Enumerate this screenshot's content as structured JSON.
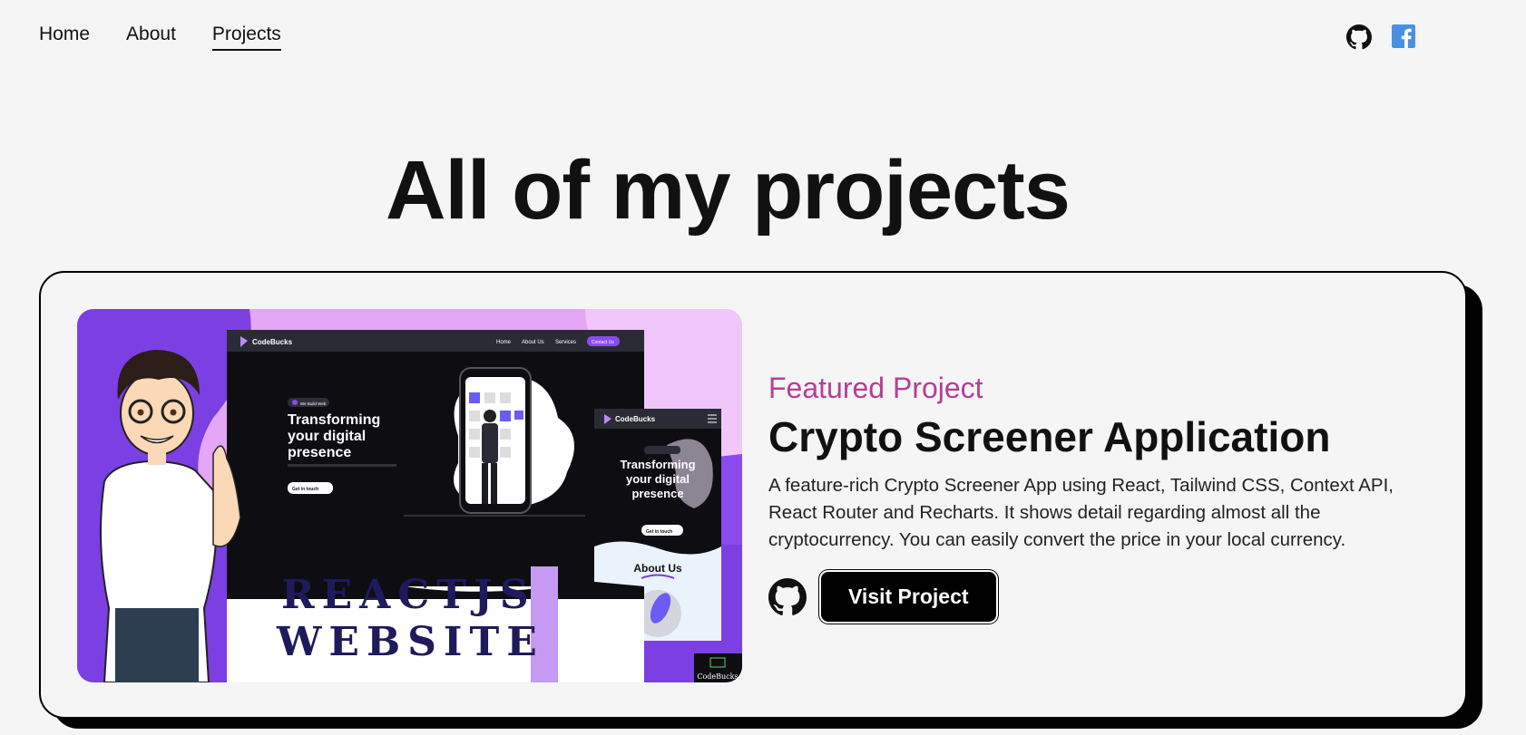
{
  "nav": {
    "items": [
      {
        "label": "Home"
      },
      {
        "label": "About"
      },
      {
        "label": "Projects",
        "active": true
      }
    ]
  },
  "socials": [
    "github-icon",
    "facebook-icon"
  ],
  "page": {
    "title": "All of my projects"
  },
  "project": {
    "tag": "Featured Project",
    "title": "Crypto Screener Application",
    "description": "A feature-rich Crypto Screener App using React, Tailwind CSS, Context API, React Router and Recharts. It shows detail regarding almost all the cryptocurrency. You can easily convert the price in your local currency.",
    "button_label": "Visit Project",
    "thumbnail": {
      "brand": "CodeBucks",
      "nav": [
        "Home",
        "About Us",
        "Services",
        "Contact Us"
      ],
      "badge": "We Build Web",
      "headline": [
        "Transforming",
        "your digital",
        "presence"
      ],
      "cta": "Get in touch",
      "mobile_section": "About Us",
      "banner_line1": "REACTJS",
      "banner_line2": "WEBSITE",
      "watermark": "CodeBucks"
    }
  },
  "colors": {
    "accent": "#b63e96",
    "purple": "#7b3fe4",
    "lavender": "#e3a7f5",
    "navy": "#1f1a5c"
  }
}
